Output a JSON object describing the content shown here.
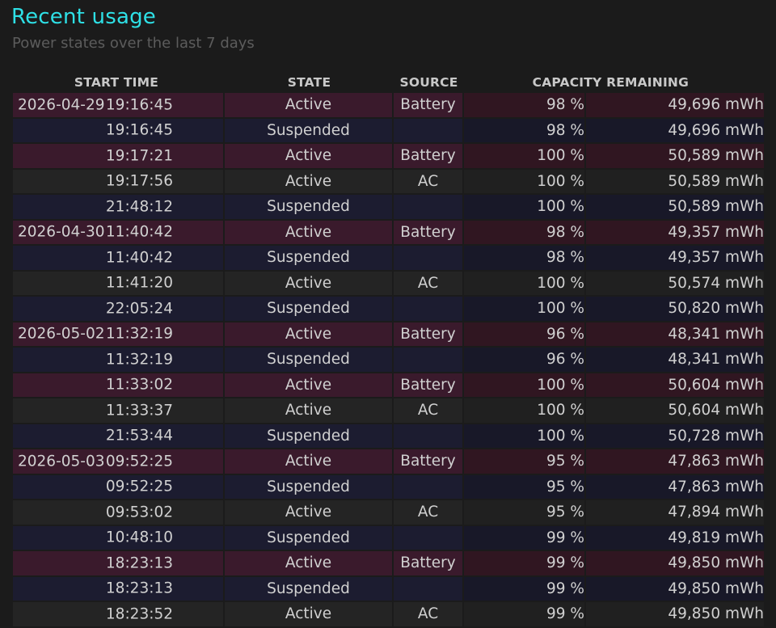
{
  "header": {
    "title": "Recent usage",
    "subtitle": "Power states over the last 7 days"
  },
  "table": {
    "columns": [
      "START TIME",
      "STATE",
      "SOURCE",
      "CAPACITY REMAINING"
    ],
    "rows": [
      {
        "date": "2026-04-29",
        "time": "19:16:45",
        "state": "Active",
        "source": "Battery",
        "percent": "98 %",
        "mwh": "49,696 mWh"
      },
      {
        "date": "",
        "time": "19:16:45",
        "state": "Suspended",
        "source": "",
        "percent": "98 %",
        "mwh": "49,696 mWh"
      },
      {
        "date": "",
        "time": "19:17:21",
        "state": "Active",
        "source": "Battery",
        "percent": "100 %",
        "mwh": "50,589 mWh"
      },
      {
        "date": "",
        "time": "19:17:56",
        "state": "Active",
        "source": "AC",
        "percent": "100 %",
        "mwh": "50,589 mWh"
      },
      {
        "date": "",
        "time": "21:48:12",
        "state": "Suspended",
        "source": "",
        "percent": "100 %",
        "mwh": "50,589 mWh"
      },
      {
        "date": "2026-04-30",
        "time": "11:40:42",
        "state": "Active",
        "source": "Battery",
        "percent": "98 %",
        "mwh": "49,357 mWh"
      },
      {
        "date": "",
        "time": "11:40:42",
        "state": "Suspended",
        "source": "",
        "percent": "98 %",
        "mwh": "49,357 mWh"
      },
      {
        "date": "",
        "time": "11:41:20",
        "state": "Active",
        "source": "AC",
        "percent": "100 %",
        "mwh": "50,574 mWh"
      },
      {
        "date": "",
        "time": "22:05:24",
        "state": "Suspended",
        "source": "",
        "percent": "100 %",
        "mwh": "50,820 mWh"
      },
      {
        "date": "2026-05-02",
        "time": "11:32:19",
        "state": "Active",
        "source": "Battery",
        "percent": "96 %",
        "mwh": "48,341 mWh"
      },
      {
        "date": "",
        "time": "11:32:19",
        "state": "Suspended",
        "source": "",
        "percent": "96 %",
        "mwh": "48,341 mWh"
      },
      {
        "date": "",
        "time": "11:33:02",
        "state": "Active",
        "source": "Battery",
        "percent": "100 %",
        "mwh": "50,604 mWh"
      },
      {
        "date": "",
        "time": "11:33:37",
        "state": "Active",
        "source": "AC",
        "percent": "100 %",
        "mwh": "50,604 mWh"
      },
      {
        "date": "",
        "time": "21:53:44",
        "state": "Suspended",
        "source": "",
        "percent": "100 %",
        "mwh": "50,728 mWh"
      },
      {
        "date": "2026-05-03",
        "time": "09:52:25",
        "state": "Active",
        "source": "Battery",
        "percent": "95 %",
        "mwh": "47,863 mWh"
      },
      {
        "date": "",
        "time": "09:52:25",
        "state": "Suspended",
        "source": "",
        "percent": "95 %",
        "mwh": "47,863 mWh"
      },
      {
        "date": "",
        "time": "09:53:02",
        "state": "Active",
        "source": "AC",
        "percent": "95 %",
        "mwh": "47,894 mWh"
      },
      {
        "date": "",
        "time": "10:48:10",
        "state": "Suspended",
        "source": "",
        "percent": "99 %",
        "mwh": "49,819 mWh"
      },
      {
        "date": "",
        "time": "18:23:13",
        "state": "Active",
        "source": "Battery",
        "percent": "99 %",
        "mwh": "49,850 mWh"
      },
      {
        "date": "",
        "time": "18:23:13",
        "state": "Suspended",
        "source": "",
        "percent": "99 %",
        "mwh": "49,850 mWh"
      },
      {
        "date": "",
        "time": "18:23:52",
        "state": "Active",
        "source": "AC",
        "percent": "99 %",
        "mwh": "49,850 mWh"
      }
    ]
  },
  "colors": {
    "title": "#2ee0e6",
    "battery_row": "#3a1a2c",
    "suspended_row": "#1c1c30",
    "ac_row": "#242424",
    "background": "#1b1b1b"
  }
}
